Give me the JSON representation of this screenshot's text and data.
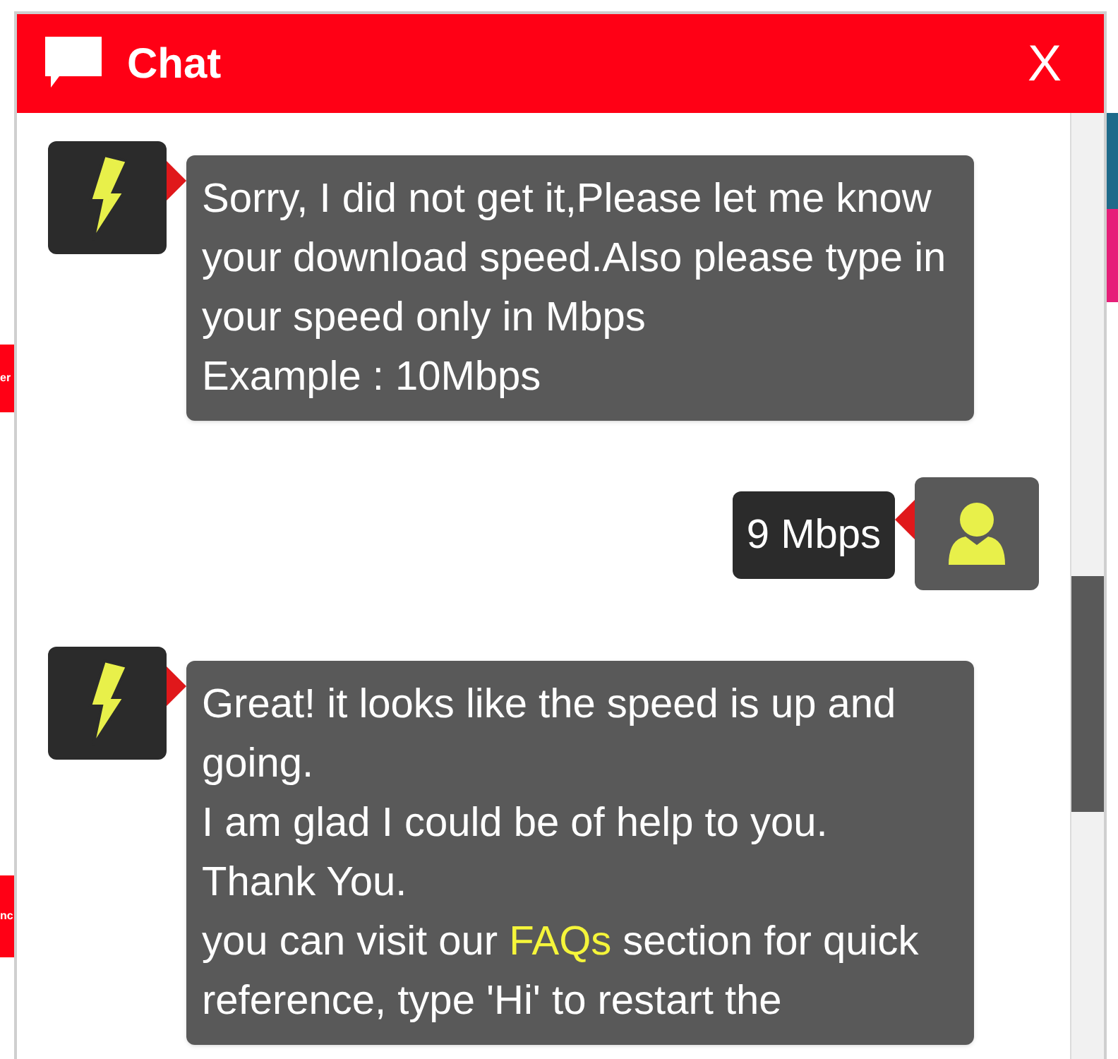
{
  "background_fragments": [
    {
      "text": "er"
    },
    {
      "text": "nc"
    }
  ],
  "window": {
    "title": "Chat",
    "close": "X"
  },
  "messages": [
    {
      "kind": "bot",
      "paragraphs": [
        {
          "text": "Sorry, I did not get it,Please let me know your download speed.Also please type in your speed only in Mbps"
        },
        {
          "text": "Example : 10Mbps"
        }
      ]
    },
    {
      "kind": "user",
      "paragraphs": [
        {
          "text": "9 Mbps"
        }
      ]
    },
    {
      "kind": "bot",
      "paragraphs": [
        {
          "text": "Great! it looks like the speed is up and going."
        },
        {
          "text": "I am glad I could be of help to you."
        },
        {
          "text": "Thank You."
        },
        {
          "text": "you can visit our ",
          "link": "FAQs",
          "after": " section for quick reference, type 'Hi' to restart the"
        }
      ]
    }
  ]
}
